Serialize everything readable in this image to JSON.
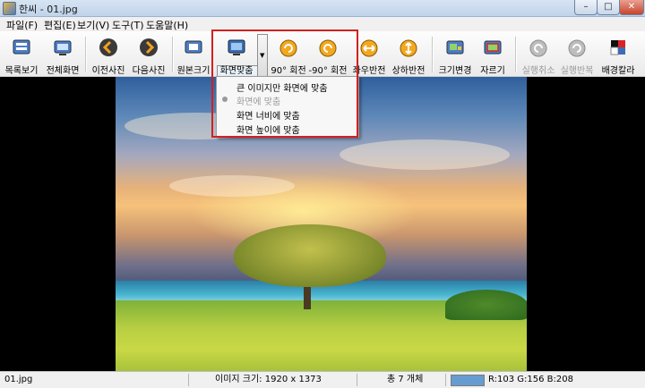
{
  "window": {
    "title": "한씨 - 01.jpg",
    "minimize": "–",
    "maximize": "□",
    "close": "✕"
  },
  "menu": [
    {
      "label": "파일(F)"
    },
    {
      "label": "편집(E)"
    },
    {
      "label": "보기(V)"
    },
    {
      "label": "도구(T)"
    },
    {
      "label": "도움말(H)"
    }
  ],
  "toolbar": {
    "list_view": "목록보기",
    "full_screen": "전체화면",
    "prev_photo": "이전사진",
    "next_photo": "다음사진",
    "original_size": "원본크기",
    "fit_screen": "화면맞춤",
    "rotate_90": "90° 회전",
    "rotate_minus_90": "-90° 회전",
    "flip_horizontal": "좌우반전",
    "flip_vertical": "상하반전",
    "resize": "크기변경",
    "crop": "자르기",
    "undo": "실행취소",
    "redo": "실행반복",
    "bg_color": "배경칼라"
  },
  "fit_menu": [
    {
      "label": "큰 이미지만 화면에 맞춤",
      "enabled": true,
      "selected": false
    },
    {
      "label": "화면에 맞춤",
      "enabled": false,
      "selected": true
    },
    {
      "label": "화면 너비에 맞춤",
      "enabled": true,
      "selected": false
    },
    {
      "label": "화면 높이에 맞춤",
      "enabled": true,
      "selected": false
    }
  ],
  "status": {
    "filename": "01.jpg",
    "image_size": "이미지 크기: 1920 x 1373",
    "count": "총 7 개체",
    "pixel_color": "R:103 G:156 B:208",
    "swatch_color": "#679cd0"
  },
  "colors": {
    "highlight": "#d22020",
    "toolbar_blue": "#3d6db5",
    "nav_orange": "#e08a12"
  }
}
